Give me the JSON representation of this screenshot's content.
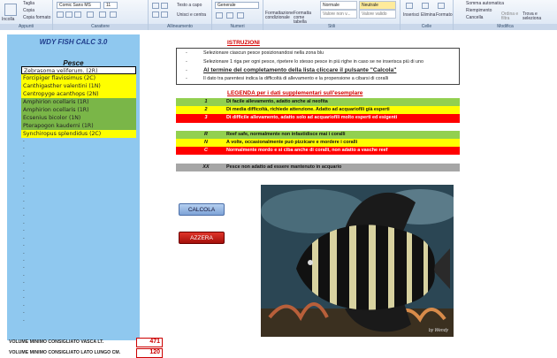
{
  "ribbon": {
    "clipboard": {
      "paste": "Incolla",
      "cut": "Taglia",
      "copy": "Copia",
      "format_painter": "Copia formato",
      "group": "Appunti"
    },
    "font": {
      "name": "Comic Sans MS",
      "size": "11",
      "group": "Carattere"
    },
    "alignment": {
      "wrap": "Testo a capo",
      "merge": "Unisci e centra",
      "group": "Allineamento"
    },
    "number": {
      "format": "Generale",
      "group": "Numeri"
    },
    "styles": {
      "cond_format": "Formattazione condizionale",
      "as_table": "Formatta come tabella",
      "normal": "Normale",
      "neutral": "Neutrale",
      "calc": "Valore non v...",
      "good": "Valore valido",
      "group": "Stili"
    },
    "cells": {
      "insert": "Inserisci",
      "delete": "Elimina",
      "format": "Formato",
      "group": "Celle"
    },
    "editing": {
      "autosum": "Somma automatica",
      "fill": "Riempimento",
      "clear": "Cancella",
      "sort": "Ordina e filtra",
      "find": "Trova e seleziona",
      "group": "Modifica"
    }
  },
  "panel": {
    "title": "WDY FISH CALC 3.0",
    "pesce_label": "Pesce",
    "fish": [
      {
        "name": "Zebrasoma veliferum. (2R)",
        "color": "#ffffff"
      },
      {
        "name": "Forcipiger flavissimus (2C)",
        "color": "#ffff00"
      },
      {
        "name": "Canthigasther valentini (1N)",
        "color": "#ffff00"
      },
      {
        "name": "Centropyge acanthops (2N)",
        "color": "#ffff00"
      },
      {
        "name": "Amphirion ocellaris (1R)",
        "color": "#7ab648"
      },
      {
        "name": "Amphirion ocellaris (1R)",
        "color": "#7ab648"
      },
      {
        "name": "Ecsenius bicolor (1N)",
        "color": "#7ab648"
      },
      {
        "name": "Pterapogon kauderni  (1R)",
        "color": "#7ab648"
      },
      {
        "name": "Synchiropus splendidus (2C)",
        "color": "#ffff00"
      }
    ],
    "empty_rows": [
      "-",
      "-",
      "-",
      "-",
      "-",
      "-",
      "-",
      "-",
      "-",
      "-",
      "-",
      "-",
      "-",
      "-",
      "-",
      "-",
      "-",
      "-",
      "-",
      "-",
      "-",
      "-",
      "-",
      "-",
      "-"
    ]
  },
  "volume": {
    "min_label": "VOLUME MINIMO CONSIGLIATO VASCA LT.",
    "min_value": "471",
    "side_label": "VOLUME MINIMO CONSIGLIATO LATO LUNGO CM.",
    "side_value": "120"
  },
  "instructions": {
    "heading": "ISTRUZIONI",
    "lines": [
      "Selezionare ciascun pesce posizionandosi nella zona blu",
      "Selezionare 1 riga per ogni pesce, ripetere lo stesso pesce in più righe in caso se ne inserisca più di uno",
      "Al termine del completamento della lista cliccare il pulsante \"Calcola\"",
      "Il dato tra parentesi indica la difficoltà di allevamento e la propensione a cibarsi di coralli"
    ],
    "bullet": "-"
  },
  "legend": {
    "heading": "LEGENDA per i dati supplementari sull'esemplare",
    "rows": [
      {
        "code": "1",
        "text": "Di facile allevamento, adatto anche al neofita",
        "bg": "#92d050",
        "fg": "#111111"
      },
      {
        "code": "2",
        "text": "Di media difficoltà, richiede attenzione. Adatto ad acquariofili già esperti",
        "bg": "#ffff00",
        "fg": "#111111"
      },
      {
        "code": "3",
        "text": "Di difficile allevamento, adatto solo ad acquariofili molto esperti ed esigenti",
        "bg": "#ff0000",
        "fg": "#ffffff"
      },
      {
        "code": "",
        "text": "",
        "bg": "#ffffff",
        "fg": "#111111"
      },
      {
        "code": "R",
        "text": "Reef safe, normalmente non infastidisce mai i coralli",
        "bg": "#92d050",
        "fg": "#111111"
      },
      {
        "code": "N",
        "text": "A volte, occasionalmente può pizzicare e mordere i coralli",
        "bg": "#ffff00",
        "fg": "#111111"
      },
      {
        "code": "C",
        "text": "Normalmente mordo e si ciba anche di coralli, non adatto a vasche reef",
        "bg": "#ff0000",
        "fg": "#ffffff"
      },
      {
        "code": "",
        "text": "",
        "bg": "#ffffff",
        "fg": "#111111"
      },
      {
        "code": "XX",
        "text": "Pesce non adatto ad essere mantenuto in acquario",
        "bg": "#a6a6a6",
        "fg": "#111111"
      }
    ]
  },
  "buttons": {
    "calcola": "CALCOLA",
    "azzera": "AZZERA"
  },
  "photo": {
    "watermark": "by Wendy"
  }
}
